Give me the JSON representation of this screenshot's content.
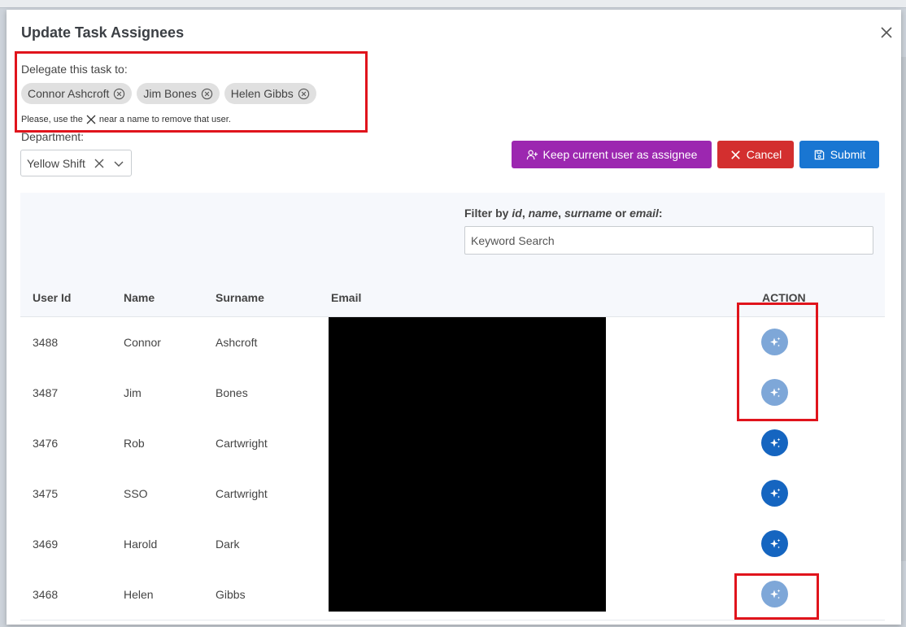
{
  "modal": {
    "title": "Update Task Assignees"
  },
  "delegate": {
    "label": "Delegate this task to:",
    "chips": [
      "Connor Ashcroft",
      "Jim Bones",
      "Helen Gibbs"
    ],
    "hint_before": "Please, use the",
    "hint_after": "near a name to remove that user."
  },
  "department": {
    "label": "Department:",
    "value": "Yellow Shift"
  },
  "buttons": {
    "keep": "Keep current user as assignee",
    "cancel": "Cancel",
    "submit": "Submit"
  },
  "filter": {
    "prefix": "Filter by",
    "f1": "id",
    "f2": "name",
    "f3": "surname",
    "or": "or",
    "f4": "email",
    "colon": ":",
    "placeholder": "Keyword Search"
  },
  "table": {
    "headers": {
      "user_id": "User Id",
      "name": "Name",
      "surname": "Surname",
      "email": "Email",
      "action": "ACTION"
    },
    "rows": [
      {
        "id": "3488",
        "name": "Connor",
        "surname": "Ashcroft",
        "assigned": true
      },
      {
        "id": "3487",
        "name": "Jim",
        "surname": "Bones",
        "assigned": true
      },
      {
        "id": "3476",
        "name": "Rob",
        "surname": "Cartwright",
        "assigned": false
      },
      {
        "id": "3475",
        "name": "SSO",
        "surname": "Cartwright",
        "assigned": false
      },
      {
        "id": "3469",
        "name": "Harold",
        "surname": "Dark",
        "assigned": false
      },
      {
        "id": "3468",
        "name": "Helen",
        "surname": "Gibbs",
        "assigned": true
      }
    ]
  },
  "colors": {
    "purple": "#9c27b0",
    "red": "#d32f2f",
    "blue": "#1976d2",
    "action_active": "#1565c0",
    "action_disabled": "#7ea7d8",
    "annotation": "#e0141c"
  },
  "icons": {
    "close": "close-icon",
    "chip_remove": "circle-x-icon",
    "person_add": "person-add-icon",
    "cancel": "x-icon",
    "submit": "save-icon",
    "action": "sparkle-icon"
  }
}
